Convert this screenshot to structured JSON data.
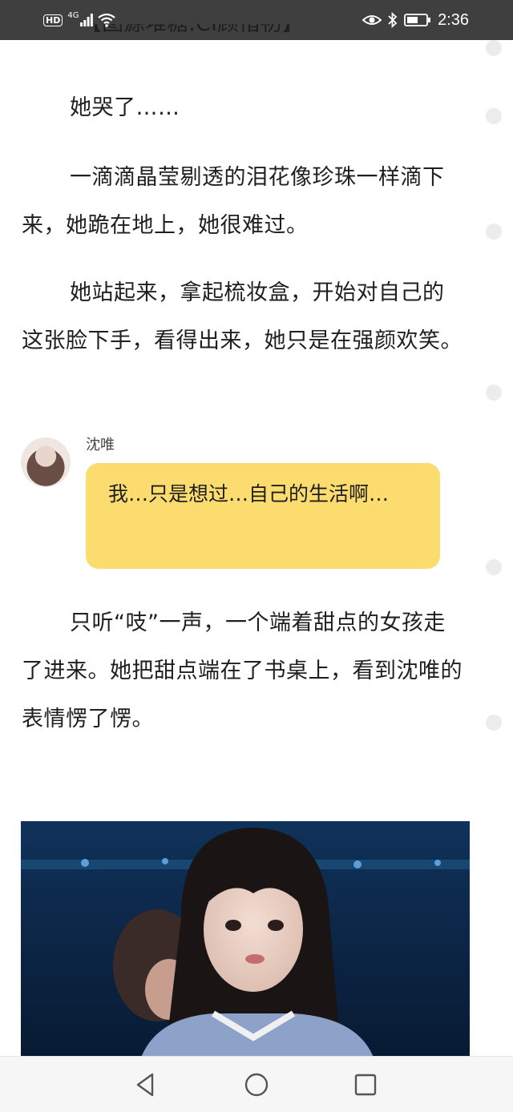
{
  "status_bar": {
    "hd_label": "HD",
    "network": "4G",
    "time": "2:36",
    "icons": [
      "hd-icon",
      "signal-icon",
      "wifi-icon",
      "eye-comfort-icon",
      "bluetooth-icon",
      "battery-icon"
    ]
  },
  "article": {
    "top_partial_caption": "【图源堆糖:CI顾惜初】",
    "paragraphs": [
      "她哭了……",
      "一滴滴晶莹剔透的泪花像珍珠一样滴下来，她跪在地上，她很难过。",
      "她站起来，拿起梳妆盒，开始对自己的这张脸下手，看得出来，她只是在强颜欢笑。",
      "只听“吱”一声，一个端着甜点的女孩走了进来。她把甜点端在了书桌上，看到沈唯的表情愣了愣。"
    ]
  },
  "chat": {
    "name": "沈唯",
    "message": "我…只是想过…自己的生活啊…"
  },
  "nav": {
    "icons": [
      "back-triangle-icon",
      "home-circle-icon",
      "recents-square-icon"
    ]
  },
  "colors": {
    "status_bar_bg": "#3f3f3f",
    "bubble_bg": "#fcdc6f",
    "side_dot": "#ececec",
    "navbar_bg": "#f6f6f6"
  }
}
